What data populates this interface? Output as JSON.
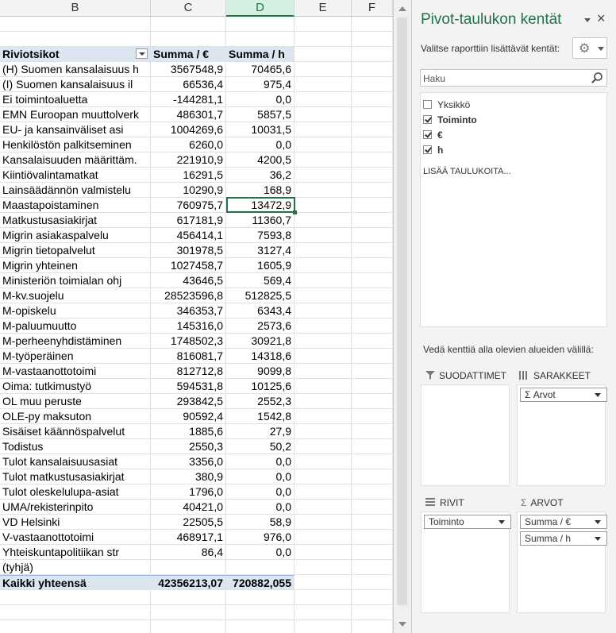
{
  "spreadsheet": {
    "columns": [
      "B",
      "C",
      "D",
      "E",
      "F"
    ],
    "selected_column": "D",
    "header": {
      "row_labels": "Riviotsikot",
      "sum_eur": "Summa  / €",
      "sum_h": "Summa  / h"
    },
    "rows": [
      {
        "label": "(H) Suomen kansalaisuus h",
        "eur": "3567548,9",
        "h": "70465,6"
      },
      {
        "label": "(I) Suomen kansalaisuus il",
        "eur": "66536,4",
        "h": "975,4"
      },
      {
        "label": "Ei  toimintoaluetta",
        "eur": "-144281,1",
        "h": "0,0"
      },
      {
        "label": "EMN Euroopan muuttolverk",
        "eur": "486301,7",
        "h": "5857,5"
      },
      {
        "label": "EU- ja kansainväliset asi",
        "eur": "1004269,6",
        "h": "10031,5"
      },
      {
        "label": "Henkilöstön palkitseminen",
        "eur": "6260,0",
        "h": "0,0"
      },
      {
        "label": "Kansalaisuuden määrittäm.",
        "eur": "221910,9",
        "h": "4200,5"
      },
      {
        "label": "Kiintiövalintamatkat",
        "eur": "16291,5",
        "h": "36,2"
      },
      {
        "label": "Lainsäädännön valmistelu",
        "eur": "10290,9",
        "h": "168,9"
      },
      {
        "label": "Maastapoistaminen",
        "eur": "760975,7",
        "h": "13472,9"
      },
      {
        "label": "Matkustusasiakirjat",
        "eur": "617181,9",
        "h": "11360,7"
      },
      {
        "label": "Migrin asiakaspalvelu",
        "eur": "456414,1",
        "h": "7593,8"
      },
      {
        "label": "Migrin tietopalvelut",
        "eur": "301978,5",
        "h": "3127,4"
      },
      {
        "label": "Migrin yhteinen",
        "eur": "1027458,7",
        "h": "1605,9"
      },
      {
        "label": "Ministeriön toimialan ohj",
        "eur": "43646,5",
        "h": "569,4"
      },
      {
        "label": "M-kv.suojelu",
        "eur": "28523596,8",
        "h": "512825,5"
      },
      {
        "label": "M-opiskelu",
        "eur": "346353,7",
        "h": "6343,4"
      },
      {
        "label": "M-paluumuutto",
        "eur": "145316,0",
        "h": "2573,6"
      },
      {
        "label": "M-perheenyhdistäminen",
        "eur": "1748502,3",
        "h": "30921,8"
      },
      {
        "label": "M-työperäinen",
        "eur": "816081,7",
        "h": "14318,6"
      },
      {
        "label": "M-vastaanottotoimi",
        "eur": "812712,8",
        "h": "9099,8"
      },
      {
        "label": "Oima: tutkimustyö",
        "eur": "594531,8",
        "h": "10125,6"
      },
      {
        "label": "OL muu peruste",
        "eur": "293842,5",
        "h": "2552,3"
      },
      {
        "label": "OLE-py maksuton",
        "eur": "90592,4",
        "h": "1542,8"
      },
      {
        "label": "Sisäiset käännöspalvelut",
        "eur": "1885,6",
        "h": "27,9"
      },
      {
        "label": "Todistus",
        "eur": "2550,3",
        "h": "50,2"
      },
      {
        "label": "Tulot kansalaisuusasiat",
        "eur": "3356,0",
        "h": "0,0"
      },
      {
        "label": "Tulot matkustusasiakirjat",
        "eur": "380,9",
        "h": "0,0"
      },
      {
        "label": "Tulot oleskelulupa-asiat",
        "eur": "1796,0",
        "h": "0,0"
      },
      {
        "label": "UMA/rekisterinpito",
        "eur": "40421,0",
        "h": "0,0"
      },
      {
        "label": "VD Helsinki",
        "eur": "22505,5",
        "h": "58,9"
      },
      {
        "label": "V-vastaanottotoimi",
        "eur": "468917,1",
        "h": "976,0"
      },
      {
        "label": "Yhteiskuntapolitiikan str",
        "eur": "86,4",
        "h": "0,0"
      },
      {
        "label": "(tyhjä)",
        "eur": "",
        "h": ""
      }
    ],
    "total": {
      "label": "Kaikki yhteensä",
      "eur": "42356213,07",
      "h": "720882,055"
    }
  },
  "pivot_pane": {
    "title": "Pivot-taulukon kentät",
    "close_glyph": "×",
    "subtitle": "Valitse raporttiin lisättävät kentät:",
    "search_placeholder": "Haku",
    "fields": [
      {
        "label": "Yksikkö",
        "checked": false,
        "bold": false
      },
      {
        "label": "Toiminto",
        "checked": true,
        "bold": true
      },
      {
        "label": "€",
        "checked": true,
        "bold": true
      },
      {
        "label": "h",
        "checked": true,
        "bold": true
      }
    ],
    "more_tables": "LISÄÄ TAULUKOITA...",
    "drag_hint": "Vedä kenttiä alla olevien alueiden välillä:",
    "areas": {
      "filters": {
        "title": "SUODATTIMET",
        "icon": "filter-icon"
      },
      "columns": {
        "title": "SARAKKEET",
        "icon": "columns-icon",
        "chips": [
          "Σ  Arvot"
        ]
      },
      "rows": {
        "title": "RIVIT",
        "icon": "rows-icon",
        "chips": [
          "Toiminto"
        ]
      },
      "values": {
        "title": "ARVOT",
        "icon": "sigma-icon",
        "chips": [
          "Summa  / €",
          "Summa  / h"
        ]
      }
    },
    "accent_color": "#217346"
  }
}
